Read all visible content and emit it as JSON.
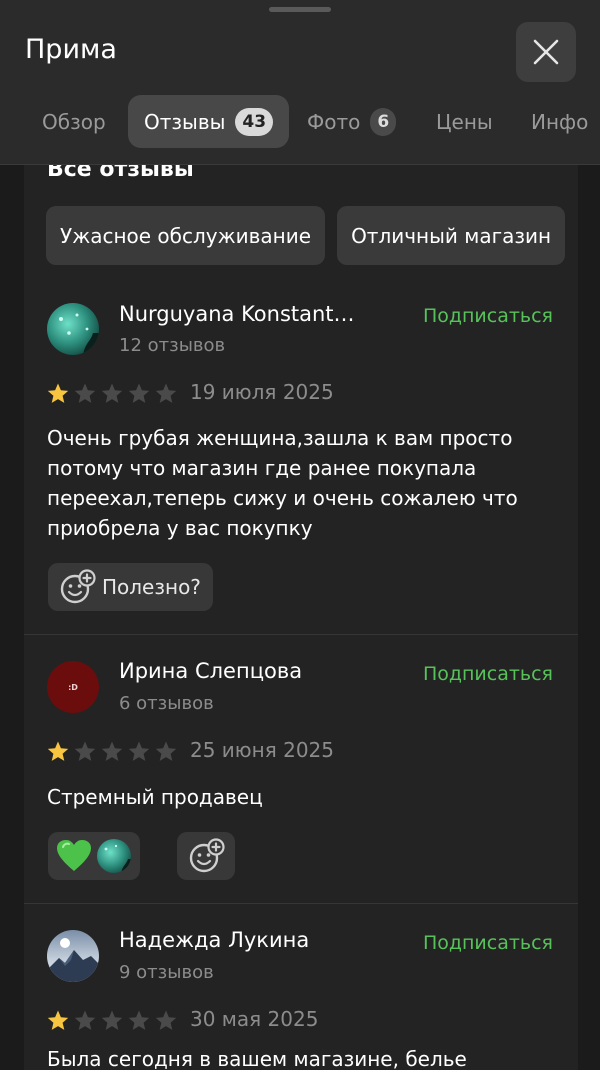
{
  "header": {
    "title": "Прима",
    "tabs": [
      {
        "label": "Обзор"
      },
      {
        "label": "Отзывы",
        "badge": "43"
      },
      {
        "label": "Фото",
        "badge": "6"
      },
      {
        "label": "Цены"
      },
      {
        "label": "Инфо"
      }
    ]
  },
  "section": {
    "title": "Все отзывы"
  },
  "chips": [
    "Ужасное обслуживание",
    "Отличный магазин"
  ],
  "colors": {
    "accent_green": "#58c25a",
    "star_filled": "#f7c53f",
    "star_empty": "#4a4a4a"
  },
  "reviews": [
    {
      "author": "Nurguyana Konstant…",
      "count": "12 отзывов",
      "subscribe": "Подписаться",
      "rating": 1,
      "date": "19 июля 2025",
      "text": "Очень грубая женщина,зашла к вам просто потому что магазин где ранее покупала переехал,теперь сижу и очень сожалею что приобрела у вас покупку",
      "useful_label": "Полезно?"
    },
    {
      "author": "Ирина Слепцова",
      "count": "6 отзывов",
      "subscribe": "Подписаться",
      "rating": 1,
      "date": "25 июня 2025",
      "text": "Стремный продавец",
      "avatar_text": ":D"
    },
    {
      "author": "Надежда Лукина",
      "count": "9 отзывов",
      "subscribe": "Подписаться",
      "rating": 1,
      "date": "30 мая 2025",
      "text": "Была сегодня в вашем магазине, белье"
    }
  ]
}
